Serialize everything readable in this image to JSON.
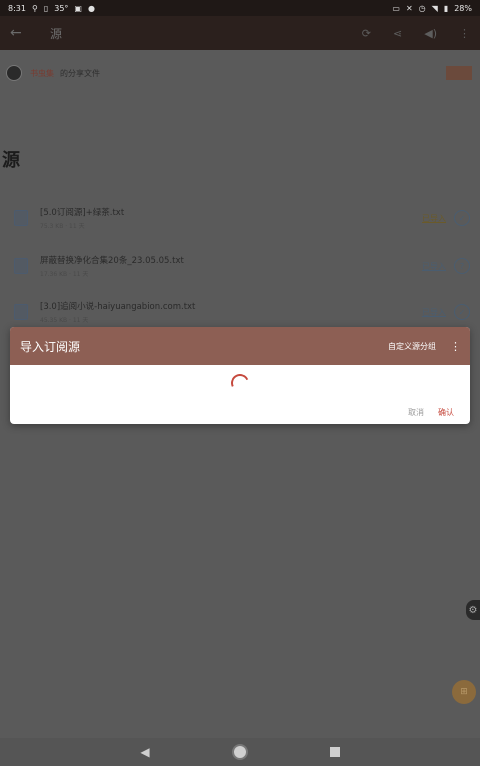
{
  "status_bar": {
    "time": "8:31",
    "temperature": "35°",
    "battery": "28%",
    "left_icons": [
      "usb-icon",
      "battery-saver-icon",
      "gallery-icon",
      "circle-icon"
    ],
    "right_icons": [
      "cast-icon",
      "mute-icon",
      "alarm-icon",
      "wifi-icon",
      "battery-icon"
    ]
  },
  "app_bar": {
    "title": "源",
    "icons": [
      "back-arrow-icon",
      "refresh-icon",
      "share-icon",
      "volume-icon",
      "more-vert-icon"
    ]
  },
  "share_row": {
    "user": "书虫集",
    "text": "的分享文件"
  },
  "heading": "源",
  "files": [
    {
      "name": "[5.0订阅源]+绿茶.txt",
      "meta": "75.3 KB · 11 天",
      "action": "已导入",
      "action_style": "warn"
    },
    {
      "name": "屏蔽替换净化合集20条_23.05.05.txt",
      "meta": "17.36 KB · 11 天",
      "action": "已导入",
      "action_style": "normal"
    },
    {
      "name": "[3.0]追阅小说-haiyuangabion.com.txt",
      "meta": "45.35 KB · 11 天",
      "action": "已导入",
      "action_style": "normal"
    }
  ],
  "dialog": {
    "title": "导入订阅源",
    "group_button": "自定义源分组",
    "cancel": "取消",
    "confirm": "确认"
  },
  "colors": {
    "dialog_header": "#8d5f54",
    "accent": "#c64a3e",
    "status_bar": "#1f1816",
    "app_bar": "#2b201d"
  }
}
